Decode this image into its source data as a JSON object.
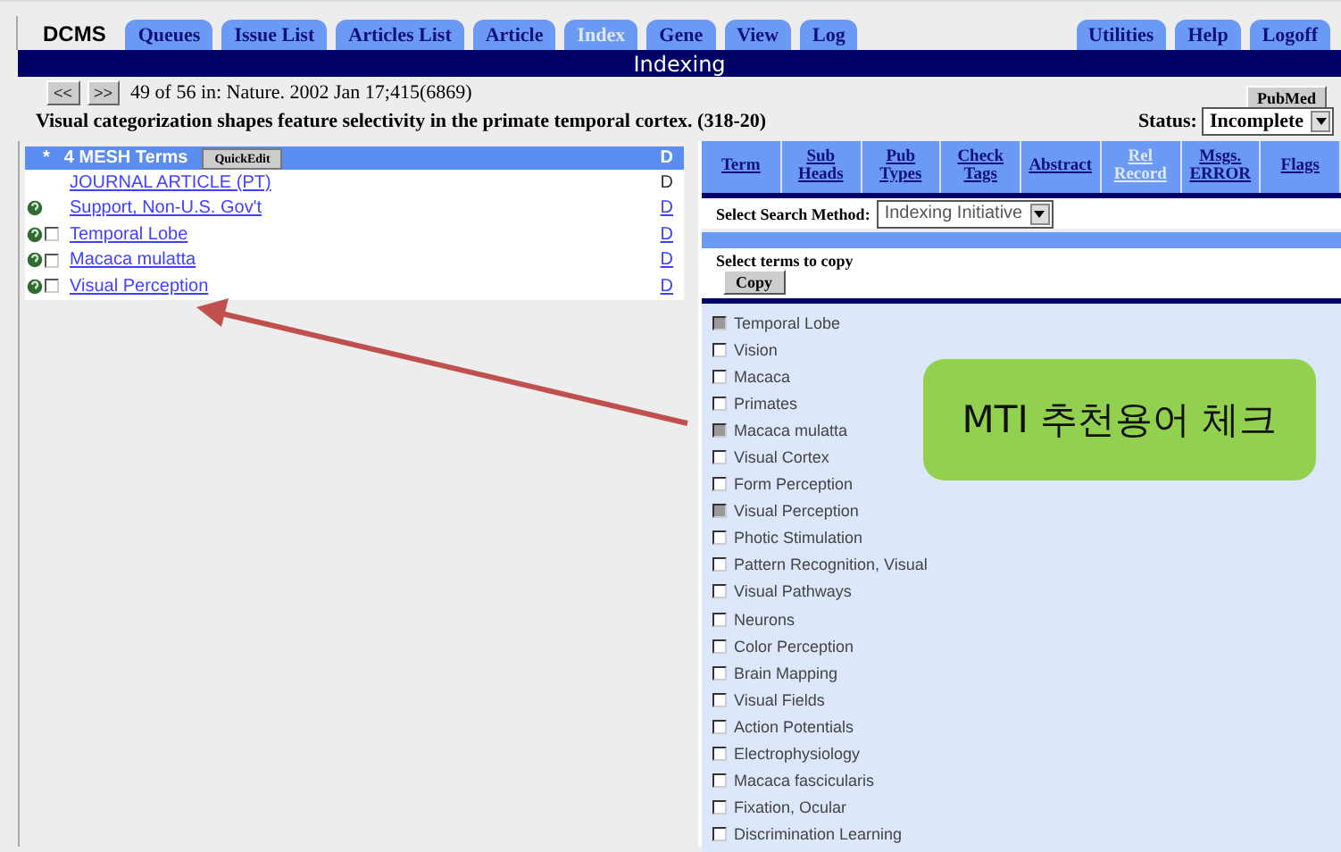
{
  "app": {
    "logo": "DCMS"
  },
  "tabs": [
    {
      "label": "Queues",
      "selected": false
    },
    {
      "label": "Issue List",
      "selected": false
    },
    {
      "label": "Articles List",
      "selected": false
    },
    {
      "label": "Article",
      "selected": false
    },
    {
      "label": "Index",
      "selected": true
    },
    {
      "label": "Gene",
      "selected": false
    },
    {
      "label": "View",
      "selected": false
    },
    {
      "label": "Log",
      "selected": false
    }
  ],
  "right_tabs": [
    {
      "label": "Utilities",
      "selected": false
    },
    {
      "label": "Help",
      "selected": false
    },
    {
      "label": "Logoff",
      "selected": false
    }
  ],
  "section_title": "Indexing",
  "nav": {
    "prev": "<<",
    "next": ">>",
    "position": "49 of 56 in:  Nature. 2002 Jan 17;415(6869)",
    "pubmed_button": "PubMed"
  },
  "article_title": "Visual categorization shapes feature selectivity in the primate temporal cortex. (318-20)",
  "status": {
    "label": "Status:",
    "value": "Incomplete"
  },
  "mesh": {
    "marker": "*",
    "title": "4 MESH Terms",
    "quickedit": "QuickEdit",
    "header_d": "D",
    "rows": [
      {
        "term": "JOURNAL ARTICLE (PT)",
        "icon": false,
        "checkbox": false,
        "d": "D",
        "d_link": false
      },
      {
        "term": "Support, Non-U.S. Gov't",
        "icon": true,
        "checkbox": false,
        "d": "D",
        "d_link": true
      },
      {
        "term": "Temporal Lobe",
        "icon": true,
        "checkbox": true,
        "checked": false,
        "d": "D",
        "d_link": true
      },
      {
        "term": "Macaca mulatta",
        "icon": true,
        "checkbox": true,
        "checked": false,
        "d": "D",
        "d_link": true
      },
      {
        "term": "Visual Perception",
        "icon": true,
        "checkbox": true,
        "checked": false,
        "d": "D",
        "d_link": true
      }
    ]
  },
  "columns": [
    {
      "label": "Term",
      "disabled": false
    },
    {
      "label": "Sub Heads",
      "disabled": false
    },
    {
      "label": "Pub Types",
      "disabled": false
    },
    {
      "label": "Check Tags",
      "disabled": false
    },
    {
      "label": "Abstract",
      "disabled": false
    },
    {
      "label": "Rel Record",
      "disabled": true
    },
    {
      "label": "Msgs. ERROR",
      "disabled": false
    },
    {
      "label": "Flags",
      "disabled": false
    }
  ],
  "search_method": {
    "label": "Select Search Method:",
    "value": "Indexing Initiative"
  },
  "copy": {
    "label": "Select terms to copy",
    "button": "Copy"
  },
  "candidates": [
    {
      "label": "Temporal Lobe",
      "disabled": true
    },
    {
      "label": "Vision",
      "disabled": false
    },
    {
      "label": "Macaca",
      "disabled": false
    },
    {
      "label": "Primates",
      "disabled": false
    },
    {
      "label": "Macaca mulatta",
      "disabled": true
    },
    {
      "label": "Visual Cortex",
      "disabled": false
    },
    {
      "label": "Form Perception",
      "disabled": false
    },
    {
      "label": "Visual Perception",
      "disabled": true
    },
    {
      "label": "Photic Stimulation",
      "disabled": false
    },
    {
      "label": "Pattern Recognition, Visual",
      "disabled": false
    },
    {
      "label": "Visual Pathways",
      "disabled": false
    },
    {
      "label": "Neurons",
      "disabled": false
    },
    {
      "label": "Color Perception",
      "disabled": false
    },
    {
      "label": "Brain Mapping",
      "disabled": false
    },
    {
      "label": "Visual Fields",
      "disabled": false
    },
    {
      "label": "Action Potentials",
      "disabled": false
    },
    {
      "label": "Electrophysiology",
      "disabled": false
    },
    {
      "label": "Macaca fascicularis",
      "disabled": false
    },
    {
      "label": "Fixation, Ocular",
      "disabled": false
    },
    {
      "label": "Discrimination Learning",
      "disabled": false
    }
  ],
  "callout": {
    "text": "MTI 추천용어 체크"
  }
}
